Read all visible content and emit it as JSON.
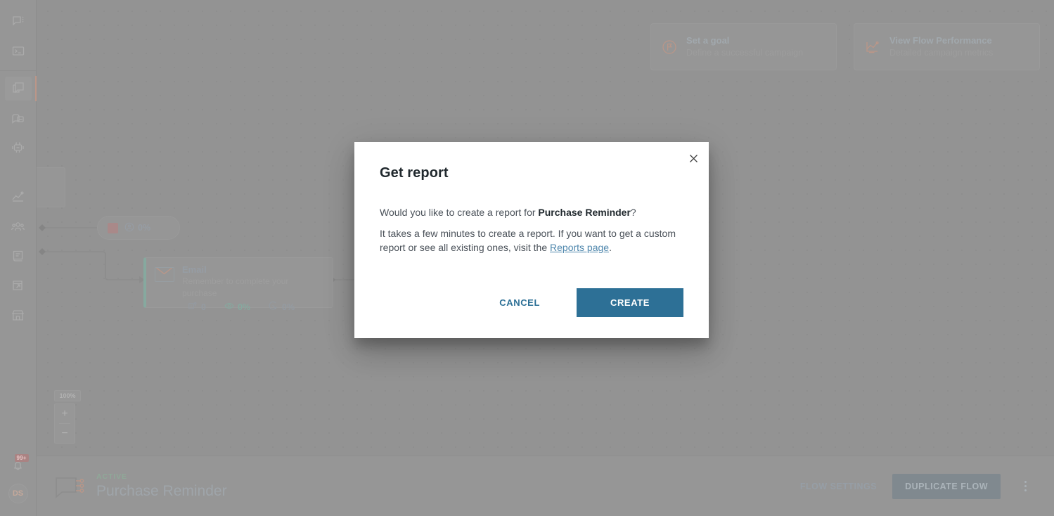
{
  "rail": {
    "top_items": [
      {
        "name": "comments-icon",
        "label": "Comments"
      },
      {
        "name": "console-icon",
        "label": "Console"
      }
    ],
    "main_items": [
      {
        "name": "flows-icon",
        "label": "Flows",
        "active": true
      },
      {
        "name": "broadcasts-icon",
        "label": "Broadcasts",
        "active": false
      },
      {
        "name": "bots-icon",
        "label": "Bots",
        "active": false
      }
    ],
    "lower_items": [
      {
        "name": "analytics-icon",
        "label": "Analytics"
      },
      {
        "name": "audience-icon",
        "label": "Audience"
      },
      {
        "name": "content-icon",
        "label": "Content"
      },
      {
        "name": "widgets-icon",
        "label": "Widgets"
      },
      {
        "name": "store-icon",
        "label": "Store"
      }
    ],
    "notifications": {
      "badge": "99+",
      "icon": "bell-icon"
    },
    "avatar_initials": "DS"
  },
  "canvas": {
    "cards": [
      {
        "icon": "flag-icon",
        "title": "Set a goal",
        "subtitle": "Define a successful campaign"
      },
      {
        "icon": "chart-line-icon",
        "title": "View Flow Performance",
        "subtitle": "Detailed campaign metrics"
      }
    ],
    "pill_node": {
      "icon": "audience-circle-icon",
      "value": "0%"
    },
    "email_node": {
      "icon": "envelope-icon",
      "title": "Email",
      "subtitle": "Remember to complete your purchase",
      "stats": [
        {
          "icon": "sent-icon",
          "value": "0"
        },
        {
          "icon": "eye-icon",
          "value": "0%"
        },
        {
          "icon": "click-icon",
          "value": "0%"
        }
      ]
    },
    "zoom": {
      "level": "100%",
      "zoom_in_label": "+",
      "zoom_out_label": "−"
    }
  },
  "bottom_bar": {
    "flow_icon": "flow-icon",
    "status": "ACTIVE",
    "title": "Purchase Reminder",
    "flow_settings_label": "FLOW SETTINGS",
    "duplicate_flow_label": "DUPLICATE FLOW",
    "more_menu": "kebab-menu-icon"
  },
  "modal": {
    "close_icon": "close-icon",
    "title": "Get report",
    "question_prefix": "Would you like to create a report for ",
    "question_flow_name": "Purchase Reminder",
    "question_suffix": "?",
    "info_prefix": "It takes a few minutes to create a report. If you want to get a custom report or see all existing ones, visit the ",
    "info_link": "Reports page",
    "info_suffix": ".",
    "cancel_label": "CANCEL",
    "create_label": "CREATE"
  },
  "colors": {
    "accent_blue": "#2d7096",
    "link_blue": "#4f87ad",
    "brand_orange": "#8a4a32",
    "active_green": "#3f6b4f",
    "canvas_bg": "#454545",
    "rail_bg": "#4a4a4a"
  }
}
